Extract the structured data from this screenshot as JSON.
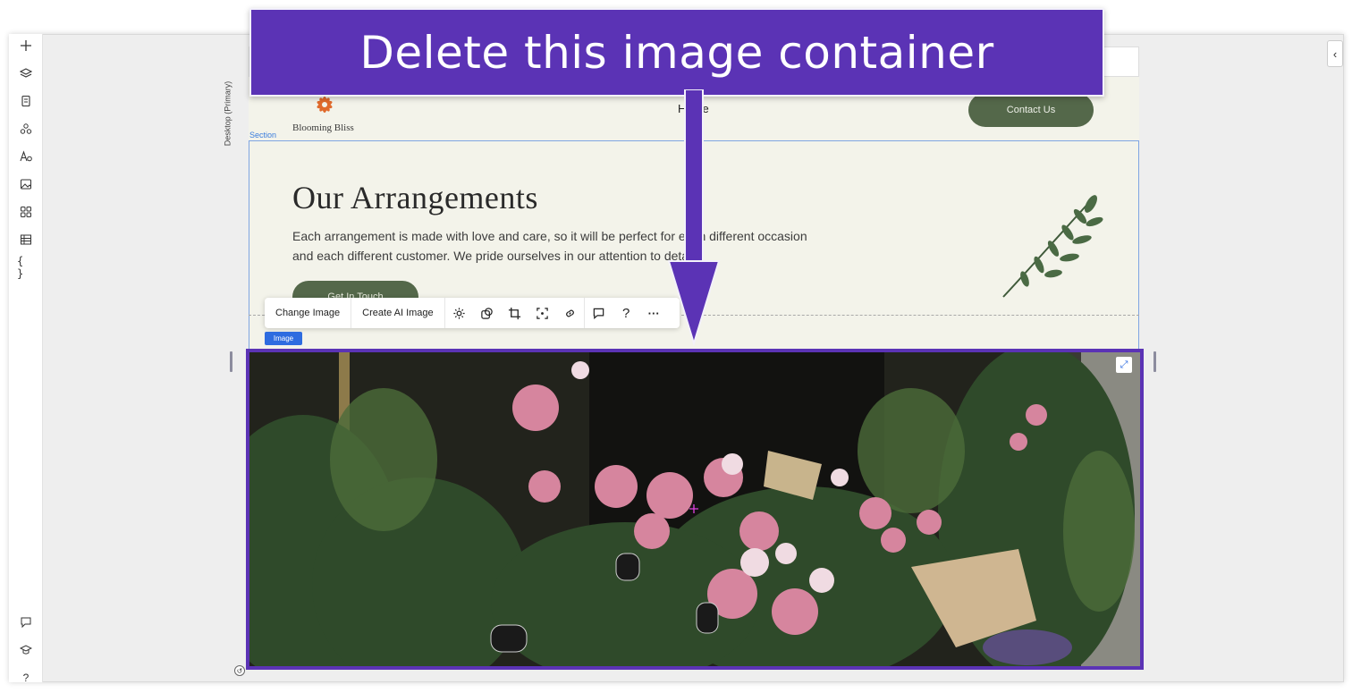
{
  "banner": {
    "text": "Delete this image container"
  },
  "left_rail": {
    "top_icons": [
      "add-icon",
      "layers-icon",
      "pages-icon",
      "apps-icon",
      "text-theme-icon",
      "media-icon",
      "widgets-icon",
      "table-icon",
      "code-icon"
    ],
    "bottom_icons": [
      "chat-icon",
      "academy-icon",
      "help-icon"
    ],
    "help_glyph": "?"
  },
  "canvas": {
    "breakpoint_label": "Desktop (Primary)",
    "section_tag": "Section",
    "image_tag": "Image"
  },
  "site": {
    "logo_text": "Blooming Bliss",
    "nav_home": "Home",
    "contact_button": "Contact Us",
    "heading": "Our Arrangements",
    "description": "Each arrangement is made with love and care, so it will be perfect for each different occasion and each different customer. We pride ourselves in our attention to detail.",
    "cta_button": "Get In Touch"
  },
  "toolbar": {
    "change_image": "Change Image",
    "create_ai_image": "Create AI Image",
    "icons": [
      "settings-icon",
      "mask-icon",
      "crop-icon",
      "focal-point-icon",
      "link-icon",
      "comment-icon",
      "help-icon",
      "more-icon"
    ],
    "help_glyph": "?",
    "more_glyph": "···"
  },
  "colors": {
    "annotation": "#5b33b5",
    "brand_green": "#54684a",
    "page_bg": "#f3f3ea",
    "selection_blue": "#2e6ce0"
  }
}
